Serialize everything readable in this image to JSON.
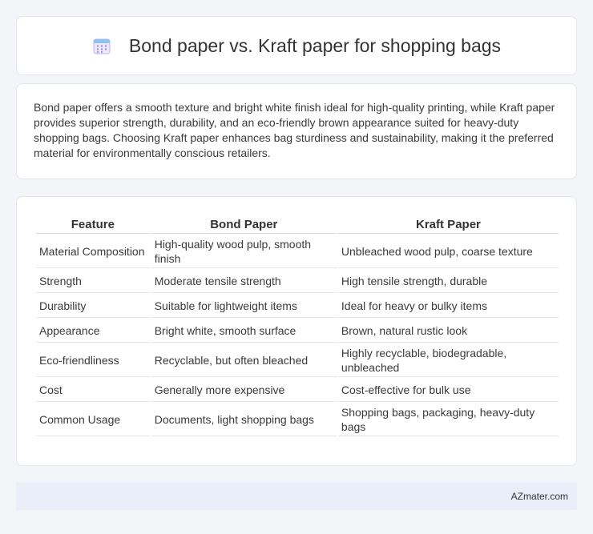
{
  "header": {
    "title": "Bond paper vs. Kraft paper for shopping bags",
    "icon": "calendar-icon"
  },
  "intro": {
    "text": "Bond paper offers a smooth texture and bright white finish ideal for high-quality printing, while Kraft paper provides superior strength, durability, and an eco-friendly brown appearance suited for heavy-duty shopping bags. Choosing Kraft paper enhances bag sturdiness and sustainability, making it the preferred material for environmentally conscious retailers."
  },
  "table": {
    "headers": [
      "Feature",
      "Bond Paper",
      "Kraft Paper"
    ],
    "rows": [
      [
        "Material Composition",
        "High-quality wood pulp, smooth finish",
        "Unbleached wood pulp, coarse texture"
      ],
      [
        "Strength",
        "Moderate tensile strength",
        "High tensile strength, durable"
      ],
      [
        "Durability",
        "Suitable for lightweight items",
        "Ideal for heavy or bulky items"
      ],
      [
        "Appearance",
        "Bright white, smooth surface",
        "Brown, natural rustic look"
      ],
      [
        "Eco-friendliness",
        "Recyclable, but often bleached",
        "Highly recyclable, biodegradable, unbleached"
      ],
      [
        "Cost",
        "Generally more expensive",
        "Cost-effective for bulk use"
      ],
      [
        "Common Usage",
        "Documents, light shopping bags",
        "Shopping bags, packaging, heavy-duty bags"
      ]
    ]
  },
  "footer": {
    "text": "AZmater.com"
  },
  "colors": {
    "background": "#f3f5f9",
    "card": "#ffffff",
    "footer": "#e9eef8",
    "icon_accent": "#8b7fd6"
  }
}
